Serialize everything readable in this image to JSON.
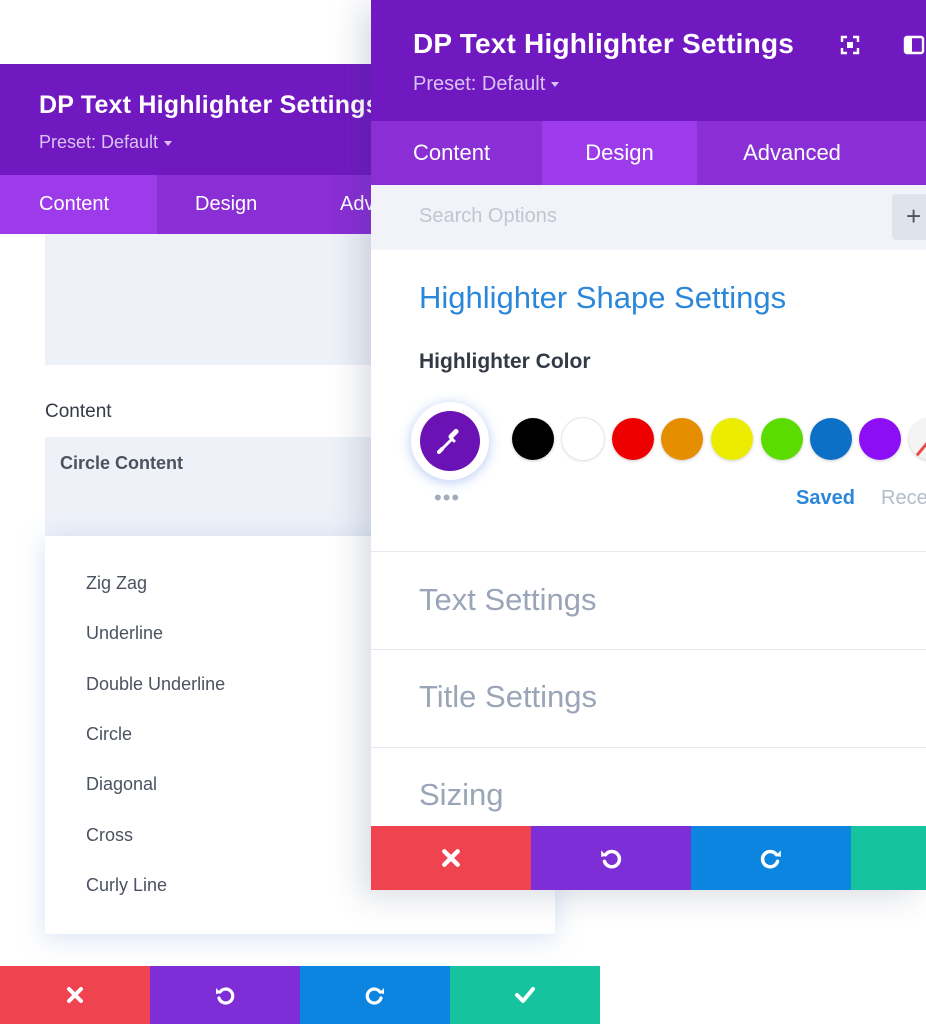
{
  "colors": {
    "header_purple": "#7119c1",
    "tab_purple": "#8a2ed6",
    "tab_active": "#9d3bea",
    "accent_blue": "#2b87da",
    "cancel_red": "#ef4350",
    "undo_purple": "#7d2ed6",
    "redo_blue": "#0c85e0",
    "save_green": "#16c39f"
  },
  "back_panel": {
    "title": "DP Text Highlighter Settings",
    "preset": "Preset: Default",
    "tabs": [
      {
        "label": "Content",
        "active": true
      },
      {
        "label": "Design",
        "active": false
      },
      {
        "label": "Advanced",
        "active": false
      }
    ],
    "content_label": "Content",
    "select_value": "Circle Content",
    "dropdown_options": [
      "Zig Zag",
      "Underline",
      "Double Underline",
      "Circle",
      "Diagonal",
      "Cross",
      "Curly Line"
    ],
    "footer": {
      "cancel_icon": "close-icon",
      "undo_icon": "undo-icon",
      "redo_icon": "redo-icon",
      "save_icon": "check-icon"
    }
  },
  "front_panel": {
    "title": "DP Text Highlighter Settings",
    "preset": "Preset: Default",
    "header_icons": [
      "fullscreen-icon",
      "sidebar-icon"
    ],
    "tabs": [
      {
        "label": "Content",
        "active": false
      },
      {
        "label": "Design",
        "active": true
      },
      {
        "label": "Advanced",
        "active": false
      }
    ],
    "search_placeholder": "Search Options",
    "add_button": "+",
    "section_title": "Highlighter Shape Settings",
    "color_label": "Highlighter Color",
    "picker_icon": "eyedropper-icon",
    "more_dots": "•••",
    "swatches": [
      {
        "name": "black",
        "color": "#000000"
      },
      {
        "name": "white",
        "color": "#ffffff"
      },
      {
        "name": "red",
        "color": "#ee0000"
      },
      {
        "name": "orange",
        "color": "#e58e00"
      },
      {
        "name": "yellow",
        "color": "#ecec00"
      },
      {
        "name": "green",
        "color": "#5bdc00"
      },
      {
        "name": "blue",
        "color": "#0c71c6"
      },
      {
        "name": "purple",
        "color": "#8b0ef5"
      },
      {
        "name": "none",
        "color": "transparent"
      }
    ],
    "saved_label": "Saved",
    "recent_label": "Recent",
    "toggles": [
      "Text Settings",
      "Title Settings",
      "Sizing"
    ]
  }
}
